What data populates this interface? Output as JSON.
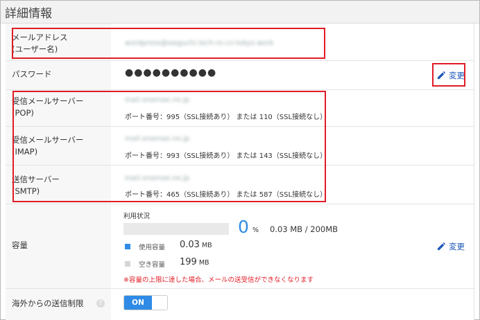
{
  "header": {
    "title": "詳細情報"
  },
  "email": {
    "label_line1": "メールアドレス",
    "label_line2": "(ユーザー名)",
    "value": "wordpress@saiguchi.tech-ro.co-tokyo.work"
  },
  "password": {
    "label": "パスワード",
    "masked": "●●●●●●●●●●",
    "edit_label": "変更"
  },
  "pop": {
    "label_line1": "受信メールサーバー",
    "label_line2": "(POP)",
    "host": "mail.onamae.ne.jp",
    "ports": "ポート番号：995（SSL接続あり） または 110（SSL接続なし）"
  },
  "imap": {
    "label_line1": "受信メールサーバー",
    "label_line2": "(IMAP)",
    "host": "mail.onamae.ne.jp",
    "ports": "ポート番号：993（SSL接続あり） または 143（SSL接続なし）"
  },
  "smtp": {
    "label_line1": "送信サーバー",
    "label_line2": "(SMTP)",
    "host": "mail.onamae.ne.jp",
    "ports": "ポート番号：465（SSL接続あり） または 587（SSL接続なし）"
  },
  "capacity": {
    "label": "容量",
    "usage_title": "利用状況",
    "percent": "0",
    "percent_unit": "%",
    "usage_fraction": 0,
    "total": "0.03 MB / 200MB",
    "used_label": "使用容量",
    "used_value": "0.03",
    "used_unit": "MB",
    "free_label": "空き容量",
    "free_value": "199",
    "free_unit": "MB",
    "warning": "※容量の上限に達した場合、メールの送受信ができなくなります",
    "edit_label": "変更"
  },
  "overseas": {
    "label": "海外からの送信制限",
    "help": "?",
    "toggle_label": "ON"
  },
  "colors": {
    "accent": "#2f8be6",
    "link": "#1a56b8",
    "highlight": "#e01b24",
    "used_square": "#2f8be6",
    "free_square": "#d6d6d6"
  }
}
